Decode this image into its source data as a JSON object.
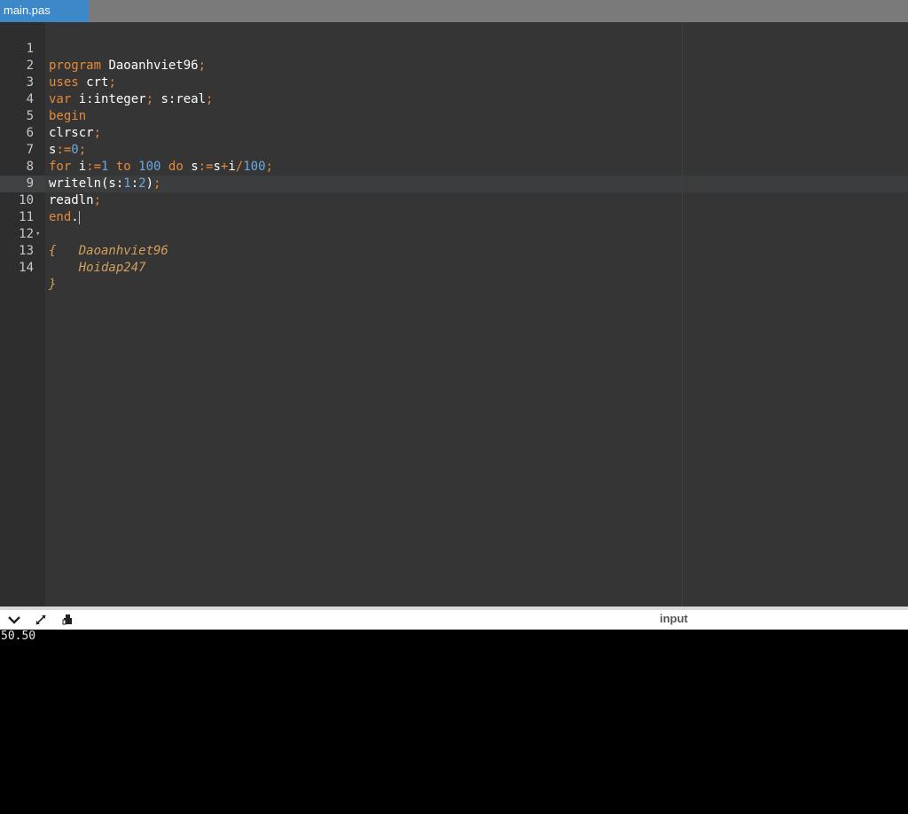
{
  "tab": {
    "label": "main.pas"
  },
  "editor": {
    "lines": [
      {
        "n": "1"
      },
      {
        "n": "2"
      },
      {
        "n": "3"
      },
      {
        "n": "4"
      },
      {
        "n": "5"
      },
      {
        "n": "6"
      },
      {
        "n": "7"
      },
      {
        "n": "8"
      },
      {
        "n": "9"
      },
      {
        "n": "10"
      },
      {
        "n": "11"
      },
      {
        "n": "12"
      },
      {
        "n": "13"
      },
      {
        "n": "14"
      }
    ],
    "tokens": {
      "l1": [
        "program",
        " Daoanhviet96",
        ";"
      ],
      "l2": [
        "uses",
        " crt",
        ";"
      ],
      "l3": [
        "var",
        " i:integer",
        ";",
        " s:real",
        ";"
      ],
      "l4": [
        "begin"
      ],
      "l5": [
        "clrscr",
        ";"
      ],
      "l6": [
        "s",
        ":=",
        "0",
        ";"
      ],
      "l7": [
        "for",
        " i",
        ":=",
        "1",
        " to ",
        "100",
        " do",
        " s",
        ":=",
        "s",
        "+",
        "i",
        "/",
        "100",
        ";"
      ],
      "l8": [
        "writeln(s:",
        "1",
        ":",
        "2",
        ")",
        ";"
      ],
      "l9": [
        "readln",
        ";"
      ],
      "l10": [
        "end",
        "."
      ],
      "l11": [
        "{"
      ],
      "l12": [
        "    Daoanhviet96"
      ],
      "l13": [
        "    Hoidap247"
      ],
      "l14": [
        "}"
      ]
    },
    "fold_marker": "▾"
  },
  "panel": {
    "label": "input",
    "output": "50.50"
  },
  "colors": {
    "tab_active": "#3c88c8",
    "editor_bg": "#353535",
    "keyword": "#e58a3a",
    "number": "#6aa8e0",
    "comment": "#d0a05c"
  },
  "icons": [
    "chevron-down-icon",
    "expand-icon",
    "clear-console-icon"
  ]
}
